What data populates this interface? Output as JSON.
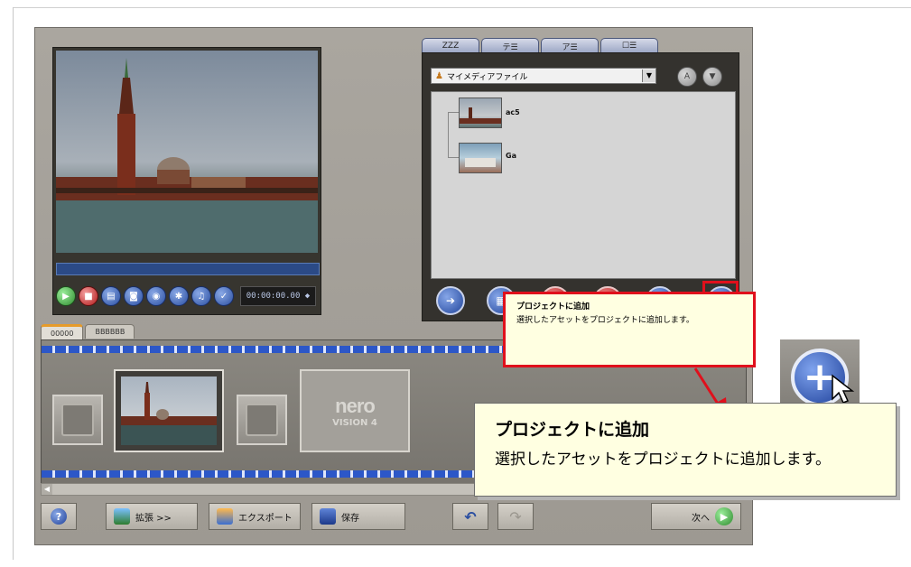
{
  "app": {
    "media_tabs": [
      "ZZZ",
      "テ☰",
      "ア☰",
      "☐☰"
    ],
    "media_source": "マイメディアファイル",
    "media_items": [
      {
        "label": "ac5"
      },
      {
        "label": "Ga"
      }
    ],
    "timecode": "00:00:00.00",
    "storyboard_tabs": [
      "00000",
      "BBBBBB"
    ],
    "logo": {
      "line1": "nero",
      "line2": "VISION 4"
    },
    "toolbar": {
      "help": "?",
      "expand_label": "拡張 >>",
      "export_label": "エクスポート",
      "save_label": "保存",
      "next_label": "次へ"
    },
    "colors": {
      "highlight": "#e0101c",
      "accent_blue": "#21459b",
      "tooltip_bg": "#ffffe1"
    }
  },
  "tooltip_small": {
    "title": "プロジェクトに追加",
    "body": "選択したアセットをプロジェクトに追加します。"
  },
  "tooltip_large": {
    "title": "プロジェクトに追加",
    "body": "選択したアセットをプロジェクトに追加します。"
  },
  "icons": {
    "add_project": "plus-circle-icon",
    "player": [
      "play-icon",
      "stop-icon",
      "capture-icon",
      "chapter-icon",
      "snapshot-icon",
      "gear-icon",
      "sound-icon",
      "check-icon"
    ],
    "media_actions": [
      "import-icon",
      "film-icon",
      "delete-icon",
      "remove-icon",
      "info-icon",
      "plus-circle-icon"
    ]
  }
}
